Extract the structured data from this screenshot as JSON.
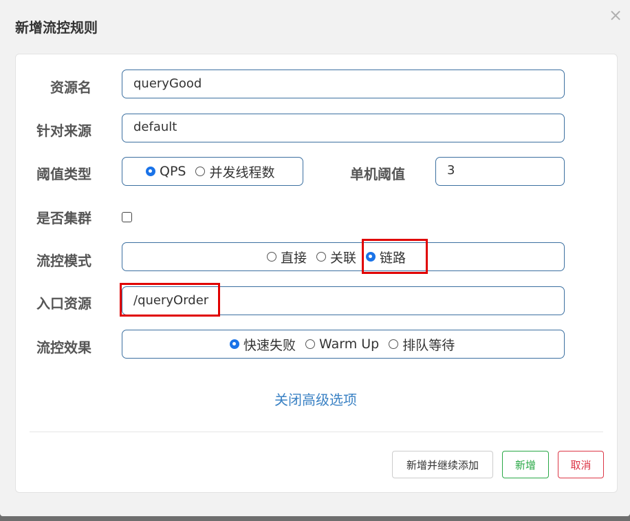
{
  "dialog": {
    "title": "新增流控规则",
    "close_glyph": "×"
  },
  "form": {
    "resource_name": {
      "label": "资源名",
      "value": "queryGood"
    },
    "limit_app": {
      "label": "针对来源",
      "value": "default"
    },
    "threshold_type": {
      "label": "阈值类型",
      "options": [
        "QPS",
        "并发线程数"
      ],
      "selected": "QPS"
    },
    "single_threshold": {
      "label": "单机阈值",
      "value": "3"
    },
    "cluster_mode": {
      "label": "是否集群",
      "checked": false
    },
    "control_mode": {
      "label": "流控模式",
      "options": [
        "直接",
        "关联",
        "链路"
      ],
      "selected": "链路"
    },
    "entry_resource": {
      "label": "入口资源",
      "value": "/queryOrder"
    },
    "control_effect": {
      "label": "流控效果",
      "options": [
        "快速失败",
        "Warm Up",
        "排队等待"
      ],
      "selected": "快速失败"
    },
    "advanced_toggle": "关闭高级选项"
  },
  "buttons": {
    "add_continue": "新增并继续添加",
    "add": "新增",
    "cancel": "取消"
  },
  "colors": {
    "field_border": "#3b6fa0",
    "radio_checked": "#1a73e8",
    "highlight": "#e00000",
    "link": "#3b82c4",
    "add_button": "#28a745",
    "cancel_button": "#dc3545"
  }
}
